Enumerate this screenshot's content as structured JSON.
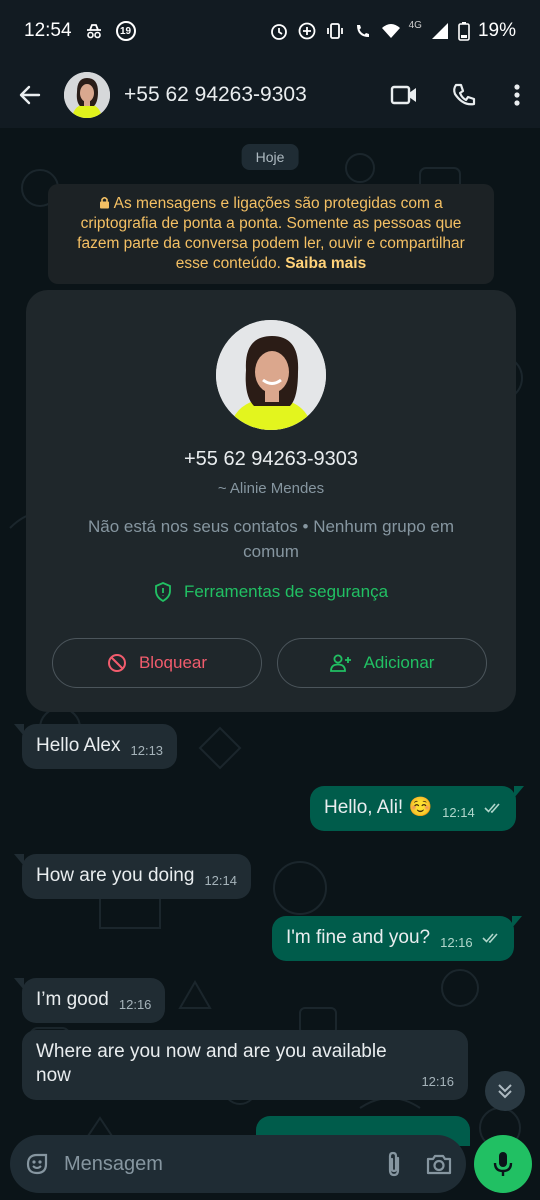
{
  "status_bar": {
    "time": "12:54",
    "notification_count": "19",
    "network": "4G",
    "battery": "19%"
  },
  "header": {
    "title": "+55 62 94263-9303",
    "icons": [
      "back-arrow-icon",
      "video-call-icon",
      "phone-icon",
      "more-vert-icon"
    ]
  },
  "date_chip": "Hoje",
  "encryption_notice": {
    "text": "As mensagens e ligações são protegidas com a criptografia de ponta a ponta. Somente as pessoas que fazem parte da conversa podem ler, ouvir e compartilhar esse conteúdo.",
    "link": "Saiba mais"
  },
  "contact_card": {
    "phone": "+55 62 94263-9303",
    "name": "~ Alinie Mendes",
    "status": "Não está nos seus contatos • Nenhum grupo em comum",
    "security_tools": "Ferramentas de segurança",
    "block_label": "Bloquear",
    "add_label": "Adicionar"
  },
  "messages": [
    {
      "direction": "in",
      "text": "Hello Alex",
      "time": "12:13"
    },
    {
      "direction": "out",
      "text": "Hello, Ali! ☺️",
      "time": "12:14",
      "status": "read"
    },
    {
      "direction": "in",
      "text": "How are you doing",
      "time": "12:14"
    },
    {
      "direction": "out",
      "text": "I'm fine and you?",
      "time": "12:16",
      "status": "read"
    },
    {
      "direction": "in",
      "text": "I’m good",
      "time": "12:16"
    },
    {
      "direction": "in",
      "text": "Where are you now and are you available now",
      "time": "12:16"
    }
  ],
  "composer": {
    "placeholder": "Mensagem"
  },
  "colors": {
    "accent": "#21c063",
    "outgoing_bubble": "#005c4b",
    "incoming_bubble": "#202c33",
    "danger": "#f15c6d",
    "notice": "#f4c064"
  }
}
